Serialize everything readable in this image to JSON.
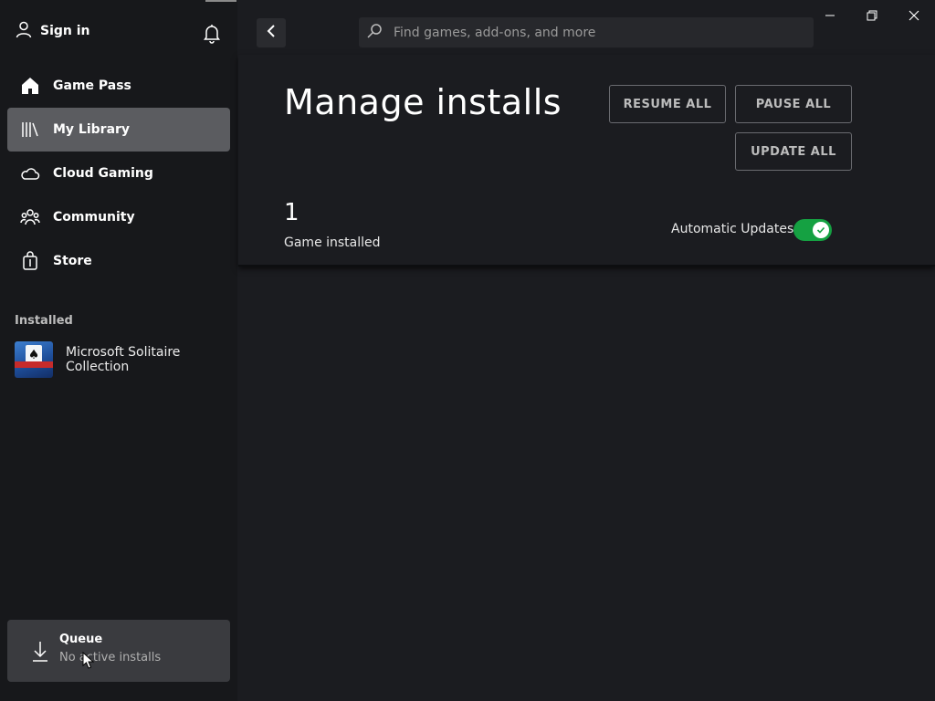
{
  "sidebar": {
    "sign_in": "Sign in",
    "nav": [
      {
        "label": "Game Pass",
        "icon": "home-icon"
      },
      {
        "label": "My Library",
        "icon": "library-icon",
        "active": true
      },
      {
        "label": "Cloud Gaming",
        "icon": "cloud-icon"
      },
      {
        "label": "Community",
        "icon": "community-icon"
      },
      {
        "label": "Store",
        "icon": "store-bag-icon"
      }
    ],
    "installed_header": "Installed",
    "installed": [
      {
        "name": "Microsoft Solitaire Collection",
        "icon": "solitaire-game-icon"
      }
    ]
  },
  "queue": {
    "title": "Queue",
    "subtitle": "No active installs"
  },
  "topbar": {
    "search_placeholder": "Find games, add-ons, and more"
  },
  "main": {
    "title": "Manage installs",
    "buttons": {
      "resume_all": "RESUME ALL",
      "pause_all": "PAUSE ALL",
      "update_all": "UPDATE ALL"
    },
    "installed_count": "1",
    "installed_count_label": "Game installed",
    "automatic_updates_label": "Automatic Updates",
    "automatic_updates_on": true
  },
  "colors": {
    "background": "#1b1c20",
    "sidebar": "#17181b",
    "active_nav": "#5b5c60",
    "toggle_on": "#15a142"
  }
}
